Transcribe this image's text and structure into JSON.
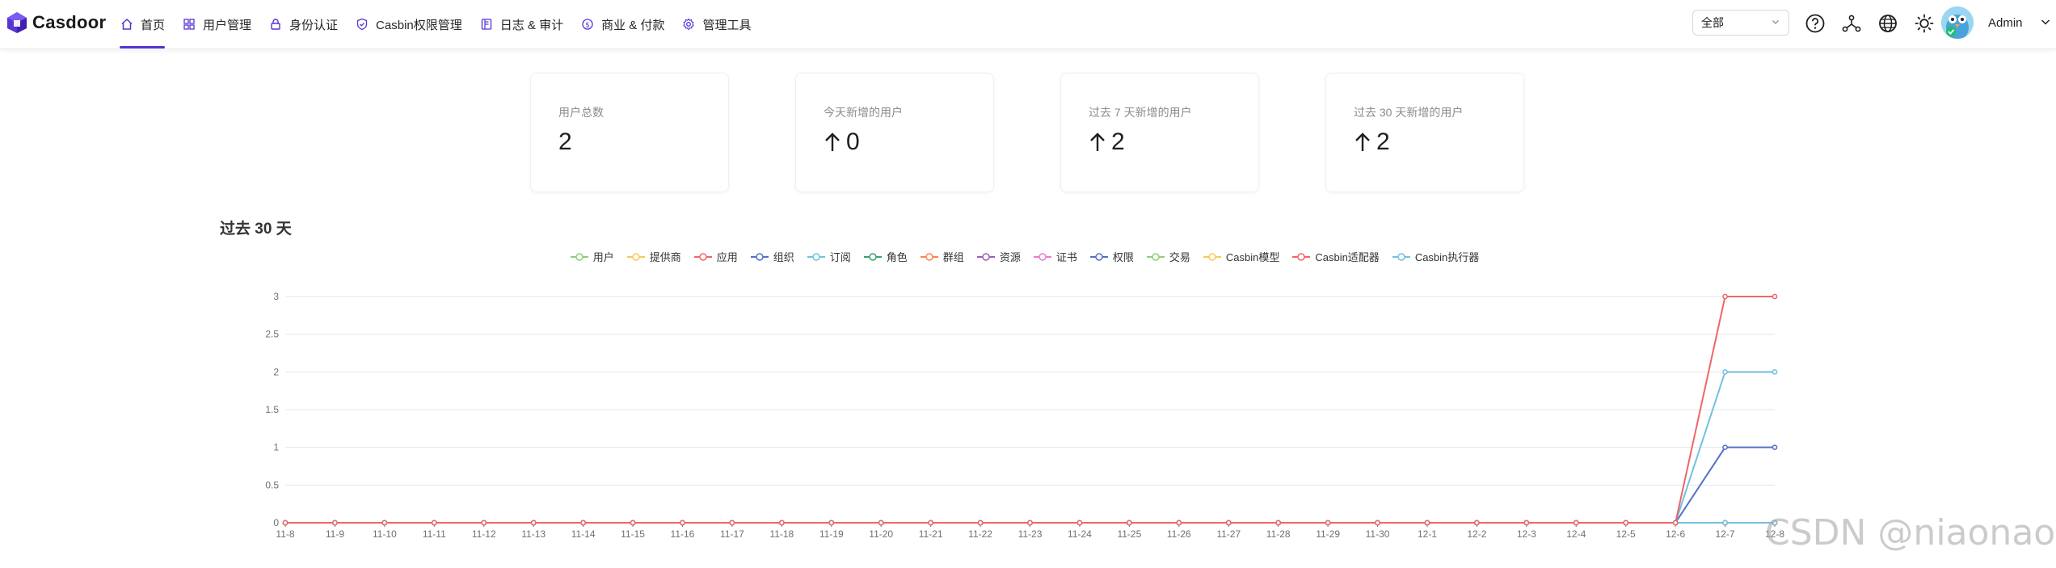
{
  "header": {
    "logo_text": "Casdoor",
    "nav": [
      {
        "label": "首页",
        "icon": "home-icon",
        "active": true
      },
      {
        "label": "用户管理",
        "icon": "grid-icon",
        "active": false
      },
      {
        "label": "身份认证",
        "icon": "lock-icon",
        "active": false
      },
      {
        "label": "Casbin权限管理",
        "icon": "shield-icon",
        "active": false
      },
      {
        "label": "日志 & 审计",
        "icon": "log-icon",
        "active": false
      },
      {
        "label": "商业 & 付款",
        "icon": "dollar-icon",
        "active": false
      },
      {
        "label": "管理工具",
        "icon": "gear-icon",
        "active": false
      }
    ],
    "org_select_value": "全部",
    "icons": [
      "help-icon",
      "network-icon",
      "globe-icon",
      "theme-sun-icon"
    ],
    "user_name": "Admin"
  },
  "stats": [
    {
      "title": "用户总数",
      "value": "2",
      "arrow": false
    },
    {
      "title": "今天新增的用户",
      "value": "0",
      "arrow": true
    },
    {
      "title": "过去 7 天新增的用户",
      "value": "2",
      "arrow": true
    },
    {
      "title": "过去 30 天新增的用户",
      "value": "2",
      "arrow": true
    }
  ],
  "chart_title": "过去 30 天",
  "accent_color": "#5734d3",
  "watermark": "CSDN @niaonao",
  "chart_data": {
    "type": "line",
    "x": [
      "11-8",
      "11-9",
      "11-10",
      "11-11",
      "11-12",
      "11-13",
      "11-14",
      "11-15",
      "11-16",
      "11-17",
      "11-18",
      "11-19",
      "11-20",
      "11-21",
      "11-22",
      "11-23",
      "11-24",
      "11-25",
      "11-26",
      "11-27",
      "11-28",
      "11-29",
      "11-30",
      "12-1",
      "12-2",
      "12-3",
      "12-4",
      "12-5",
      "12-6",
      "12-7",
      "12-8"
    ],
    "ylim": [
      0,
      3
    ],
    "yticks": [
      "0",
      "0.5",
      "1",
      "1.5",
      "2",
      "2.5",
      "3"
    ],
    "legend_position": "top-center",
    "grid": true,
    "series": [
      {
        "name": "用户",
        "color": "#91cc75",
        "values": [
          0,
          0,
          0,
          0,
          0,
          0,
          0,
          0,
          0,
          0,
          0,
          0,
          0,
          0,
          0,
          0,
          0,
          0,
          0,
          0,
          0,
          0,
          0,
          0,
          0,
          0,
          0,
          0,
          0,
          0,
          0
        ]
      },
      {
        "name": "提供商",
        "color": "#fac858",
        "values": [
          0,
          0,
          0,
          0,
          0,
          0,
          0,
          0,
          0,
          0,
          0,
          0,
          0,
          0,
          0,
          0,
          0,
          0,
          0,
          0,
          0,
          0,
          0,
          0,
          0,
          0,
          0,
          0,
          0,
          0,
          0
        ]
      },
      {
        "name": "应用",
        "color": "#ee6666",
        "values": [
          0,
          0,
          0,
          0,
          0,
          0,
          0,
          0,
          0,
          0,
          0,
          0,
          0,
          0,
          0,
          0,
          0,
          0,
          0,
          0,
          0,
          0,
          0,
          0,
          0,
          0,
          0,
          0,
          0,
          3,
          3
        ]
      },
      {
        "name": "组织",
        "color": "#5470c6",
        "values": [
          0,
          0,
          0,
          0,
          0,
          0,
          0,
          0,
          0,
          0,
          0,
          0,
          0,
          0,
          0,
          0,
          0,
          0,
          0,
          0,
          0,
          0,
          0,
          0,
          0,
          0,
          0,
          0,
          0,
          1,
          1
        ]
      },
      {
        "name": "订阅",
        "color": "#73c0de",
        "values": [
          0,
          0,
          0,
          0,
          0,
          0,
          0,
          0,
          0,
          0,
          0,
          0,
          0,
          0,
          0,
          0,
          0,
          0,
          0,
          0,
          0,
          0,
          0,
          0,
          0,
          0,
          0,
          0,
          0,
          2,
          2
        ]
      },
      {
        "name": "角色",
        "color": "#3ba272",
        "values": [
          0,
          0,
          0,
          0,
          0,
          0,
          0,
          0,
          0,
          0,
          0,
          0,
          0,
          0,
          0,
          0,
          0,
          0,
          0,
          0,
          0,
          0,
          0,
          0,
          0,
          0,
          0,
          0,
          0,
          0,
          0
        ]
      },
      {
        "name": "群组",
        "color": "#fc8452",
        "values": [
          0,
          0,
          0,
          0,
          0,
          0,
          0,
          0,
          0,
          0,
          0,
          0,
          0,
          0,
          0,
          0,
          0,
          0,
          0,
          0,
          0,
          0,
          0,
          0,
          0,
          0,
          0,
          0,
          0,
          0,
          0
        ]
      },
      {
        "name": "资源",
        "color": "#9a60b4",
        "values": [
          0,
          0,
          0,
          0,
          0,
          0,
          0,
          0,
          0,
          0,
          0,
          0,
          0,
          0,
          0,
          0,
          0,
          0,
          0,
          0,
          0,
          0,
          0,
          0,
          0,
          0,
          0,
          0,
          0,
          0,
          0
        ]
      },
      {
        "name": "证书",
        "color": "#ea7ccc",
        "values": [
          0,
          0,
          0,
          0,
          0,
          0,
          0,
          0,
          0,
          0,
          0,
          0,
          0,
          0,
          0,
          0,
          0,
          0,
          0,
          0,
          0,
          0,
          0,
          0,
          0,
          0,
          0,
          0,
          0,
          0,
          0
        ]
      },
      {
        "name": "权限",
        "color": "#5470c6",
        "values": [
          0,
          0,
          0,
          0,
          0,
          0,
          0,
          0,
          0,
          0,
          0,
          0,
          0,
          0,
          0,
          0,
          0,
          0,
          0,
          0,
          0,
          0,
          0,
          0,
          0,
          0,
          0,
          0,
          0,
          0,
          0
        ]
      },
      {
        "name": "交易",
        "color": "#91cc75",
        "values": [
          0,
          0,
          0,
          0,
          0,
          0,
          0,
          0,
          0,
          0,
          0,
          0,
          0,
          0,
          0,
          0,
          0,
          0,
          0,
          0,
          0,
          0,
          0,
          0,
          0,
          0,
          0,
          0,
          0,
          0,
          0
        ]
      },
      {
        "name": "Casbin模型",
        "color": "#fac858",
        "values": [
          0,
          0,
          0,
          0,
          0,
          0,
          0,
          0,
          0,
          0,
          0,
          0,
          0,
          0,
          0,
          0,
          0,
          0,
          0,
          0,
          0,
          0,
          0,
          0,
          0,
          0,
          0,
          0,
          0,
          0,
          0
        ]
      },
      {
        "name": "Casbin适配器",
        "color": "#ee6666",
        "values": [
          0,
          0,
          0,
          0,
          0,
          0,
          0,
          0,
          0,
          0,
          0,
          0,
          0,
          0,
          0,
          0,
          0,
          0,
          0,
          0,
          0,
          0,
          0,
          0,
          0,
          0,
          0,
          0,
          0,
          0,
          0
        ]
      },
      {
        "name": "Casbin执行器",
        "color": "#73c0de",
        "values": [
          0,
          0,
          0,
          0,
          0,
          0,
          0,
          0,
          0,
          0,
          0,
          0,
          0,
          0,
          0,
          0,
          0,
          0,
          0,
          0,
          0,
          0,
          0,
          0,
          0,
          0,
          0,
          0,
          0,
          0,
          0
        ]
      }
    ]
  }
}
